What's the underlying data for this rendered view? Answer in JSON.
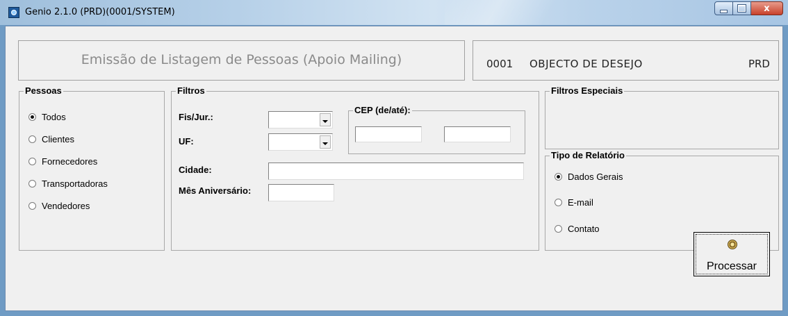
{
  "window": {
    "title": "Genio 2.1.0 (PRD)(0001/SYSTEM)",
    "close_symbol": "x"
  },
  "header": {
    "title": "Emissão de Listagem de Pessoas (Apoio Mailing)",
    "company_code": "0001",
    "company_name": "OBJECTO DE DESEJO",
    "environment": "PRD"
  },
  "pessoas": {
    "legend": "Pessoas",
    "options": [
      {
        "label": "Todos",
        "selected": true
      },
      {
        "label": "Clientes",
        "selected": false
      },
      {
        "label": "Fornecedores",
        "selected": false
      },
      {
        "label": "Transportadoras",
        "selected": false
      },
      {
        "label": "Vendedores",
        "selected": false
      }
    ]
  },
  "filtros": {
    "legend": "Filtros",
    "fis_jur_label": "Fis/Jur.:",
    "fis_jur_value": "",
    "uf_label": "UF:",
    "uf_value": "",
    "cep_legend": "CEP (de/até):",
    "cep_from": "",
    "cep_to": "",
    "cidade_label": "Cidade:",
    "cidade_value": "",
    "mes_label": "Mês Aniversário:",
    "mes_value": ""
  },
  "filtros_especiais": {
    "legend": "Filtros Especiais"
  },
  "tipo_relatorio": {
    "legend": "Tipo de Relatório",
    "options": [
      {
        "label": "Dados Gerais",
        "selected": true
      },
      {
        "label": "E-mail",
        "selected": false
      },
      {
        "label": "Contato",
        "selected": false
      }
    ]
  },
  "actions": {
    "process_label": "Processar",
    "process_icon": "gear-icon"
  }
}
